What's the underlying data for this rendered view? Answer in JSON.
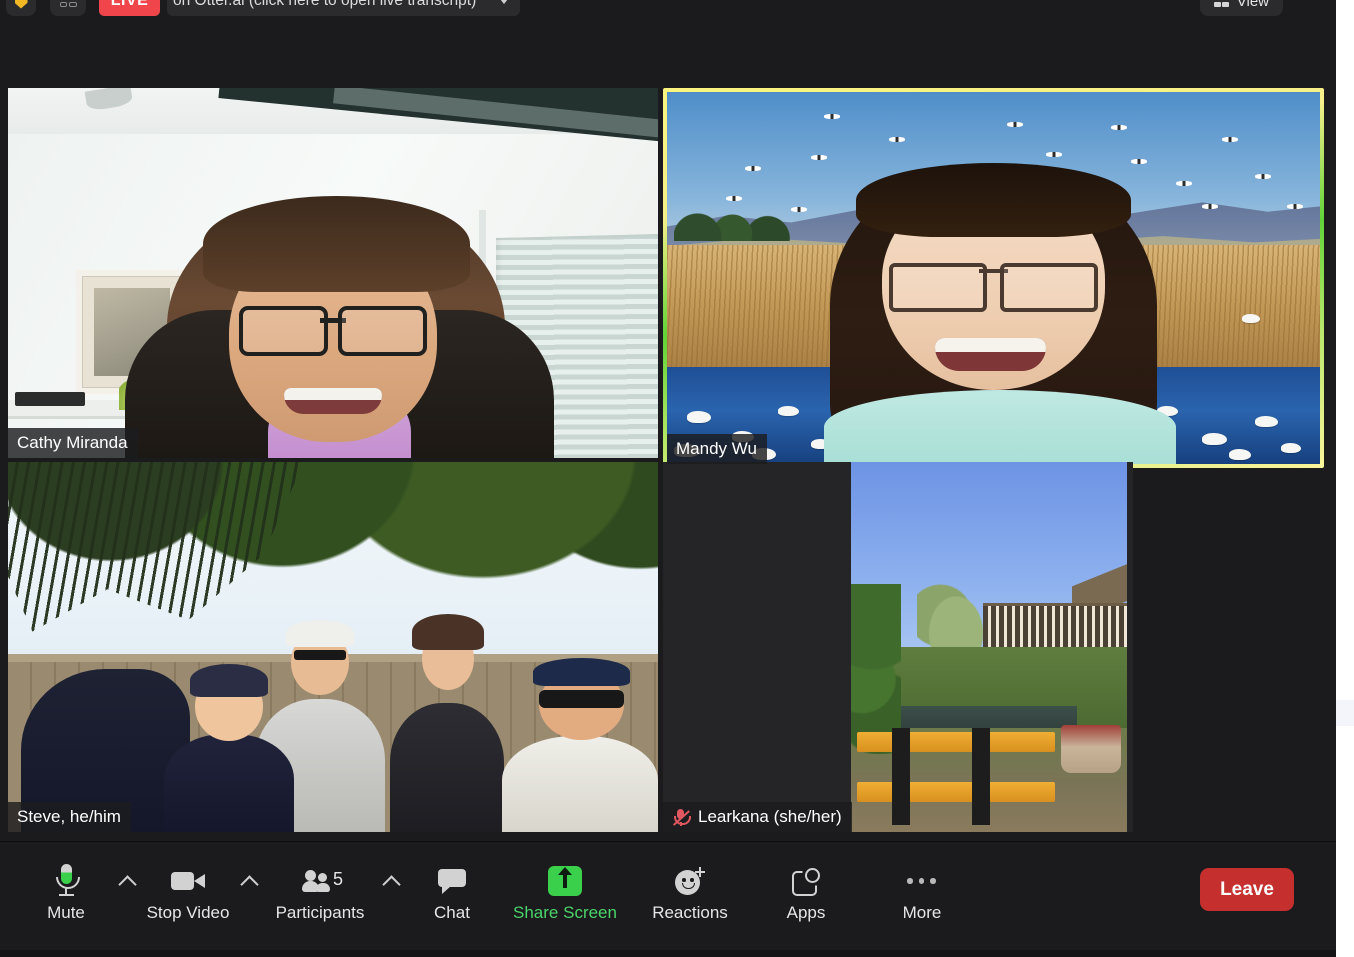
{
  "topbar": {
    "shield_icon": "shield-icon",
    "grid_icon": "grid-view-icon",
    "live_badge": "LIVE",
    "transcript_text": "on Otter.ai (click here to open live transcript)",
    "transcript_caret": "chevron-down-icon",
    "view_label": "View",
    "view_icon": "grid-icon"
  },
  "gallery": {
    "participants": [
      {
        "name": "Cathy Miranda",
        "active_speaker": false,
        "muted": false,
        "scene": "office-blinds"
      },
      {
        "name": "Mandy Wu",
        "active_speaker": true,
        "muted": false,
        "scene": "snow-geese-wetland"
      },
      {
        "name": "Steve, he/him",
        "active_speaker": false,
        "muted": false,
        "scene": "backyard-group"
      },
      {
        "name": "Learkana (she/her)",
        "active_speaker": false,
        "muted": true,
        "mute_icon": "microphone-muted-icon",
        "scene": "garden-bench"
      }
    ]
  },
  "controls": {
    "items": [
      {
        "label": "Mute",
        "icon": "microphone-icon",
        "has_caret": true,
        "caret_icon": "chevron-up-icon",
        "accent": "#3ad04c"
      },
      {
        "label": "Stop Video",
        "icon": "video-camera-icon",
        "has_caret": true,
        "caret_icon": "chevron-up-icon"
      },
      {
        "label": "Participants",
        "icon": "people-icon",
        "has_caret": true,
        "caret_icon": "chevron-up-icon",
        "count": "5"
      },
      {
        "label": "Chat",
        "icon": "speech-bubble-icon",
        "has_caret": false
      },
      {
        "label": "Share Screen",
        "icon": "share-screen-icon",
        "has_caret": false,
        "accent": "#3ad04c"
      },
      {
        "label": "Reactions",
        "icon": "emoji-plus-icon",
        "has_caret": false
      },
      {
        "label": "Apps",
        "icon": "apps-icon",
        "has_caret": false
      },
      {
        "label": "More",
        "icon": "ellipsis-icon",
        "has_caret": false
      }
    ],
    "leave_label": "Leave",
    "leave_color": "#c5302f"
  },
  "theme": {
    "window_bg": "#1b1b1d",
    "tile_bg": "#202022",
    "active_border_start": "#fbf57f",
    "active_border_mid": "#62d337",
    "text": "#e6e6e6"
  }
}
